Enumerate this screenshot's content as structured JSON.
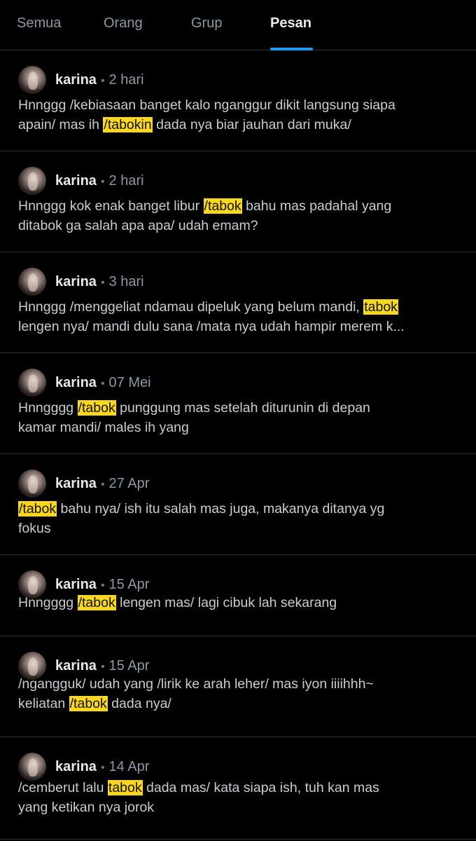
{
  "tabs": [
    {
      "label": "Semua",
      "active": false
    },
    {
      "label": "Orang",
      "active": false
    },
    {
      "label": "Grup",
      "active": false
    },
    {
      "label": "Pesan",
      "active": true
    }
  ],
  "colors": {
    "accent": "#1d9bf0",
    "highlight": "#f9d71c",
    "background": "#000000"
  },
  "results": [
    {
      "author": "karina",
      "separator": "•",
      "date": "2 hari",
      "avatar_icon": "user-avatar",
      "lines": [
        [
          "Hnnggg /kebiasaan banget kalo nganggur dikit langsung siapa"
        ],
        [
          "apain/ mas ih ",
          "/tabokin",
          " dada nya biar jauhan dari muka/"
        ]
      ]
    },
    {
      "author": "karina",
      "separator": "•",
      "date": "2 hari",
      "avatar_icon": "user-avatar",
      "lines": [
        [
          "Hnnggg kok enak banget libur ",
          "/tabok",
          " bahu mas padahal yang"
        ],
        [
          "ditabok ga salah apa apa/ udah emam?"
        ]
      ]
    },
    {
      "author": "karina",
      "separator": "•",
      "date": "3 hari",
      "avatar_icon": "user-avatar",
      "lines": [
        [
          "Hnnggg /menggeliat ndamau dipeluk yang belum mandi, ",
          "tabok",
          ""
        ],
        [
          "lengen nya/ mandi dulu sana /mata nya udah hampir merem k..."
        ]
      ]
    },
    {
      "author": "karina",
      "separator": "•",
      "date": "07 Mei",
      "avatar_icon": "user-avatar",
      "lines": [
        [
          "Hnngggg ",
          "/tabok",
          " punggung mas setelah diturunin di depan"
        ],
        [
          "kamar mandi/ males ih yang"
        ]
      ]
    },
    {
      "author": "karina",
      "separator": "•",
      "date": "27 Apr",
      "avatar_icon": "user-avatar",
      "lines": [
        [
          "",
          "/tabok",
          " bahu nya/ ish itu salah mas juga, makanya ditanya yg"
        ],
        [
          "fokus"
        ]
      ]
    },
    {
      "author": "karina",
      "separator": "•",
      "date": "15 Apr",
      "avatar_icon": "user-avatar",
      "lines": [
        [
          "Hnngggg ",
          "/tabok",
          " lengen mas/ lagi cibuk lah sekarang"
        ]
      ]
    },
    {
      "author": "karina",
      "separator": "•",
      "date": "15 Apr",
      "avatar_icon": "user-avatar",
      "lines": [
        [
          "/ngangguk/ udah yang /lirik ke arah leher/ mas iyon iiiihhh~"
        ],
        [
          "keliatan ",
          "/tabok",
          " dada nya/"
        ]
      ]
    },
    {
      "author": "karina",
      "separator": "•",
      "date": "14 Apr",
      "avatar_icon": "user-avatar",
      "lines": [
        [
          "/cemberut lalu ",
          "tabok",
          " dada mas/ kata siapa ish, tuh kan mas"
        ],
        [
          "yang ketikan nya jorok"
        ]
      ]
    }
  ]
}
